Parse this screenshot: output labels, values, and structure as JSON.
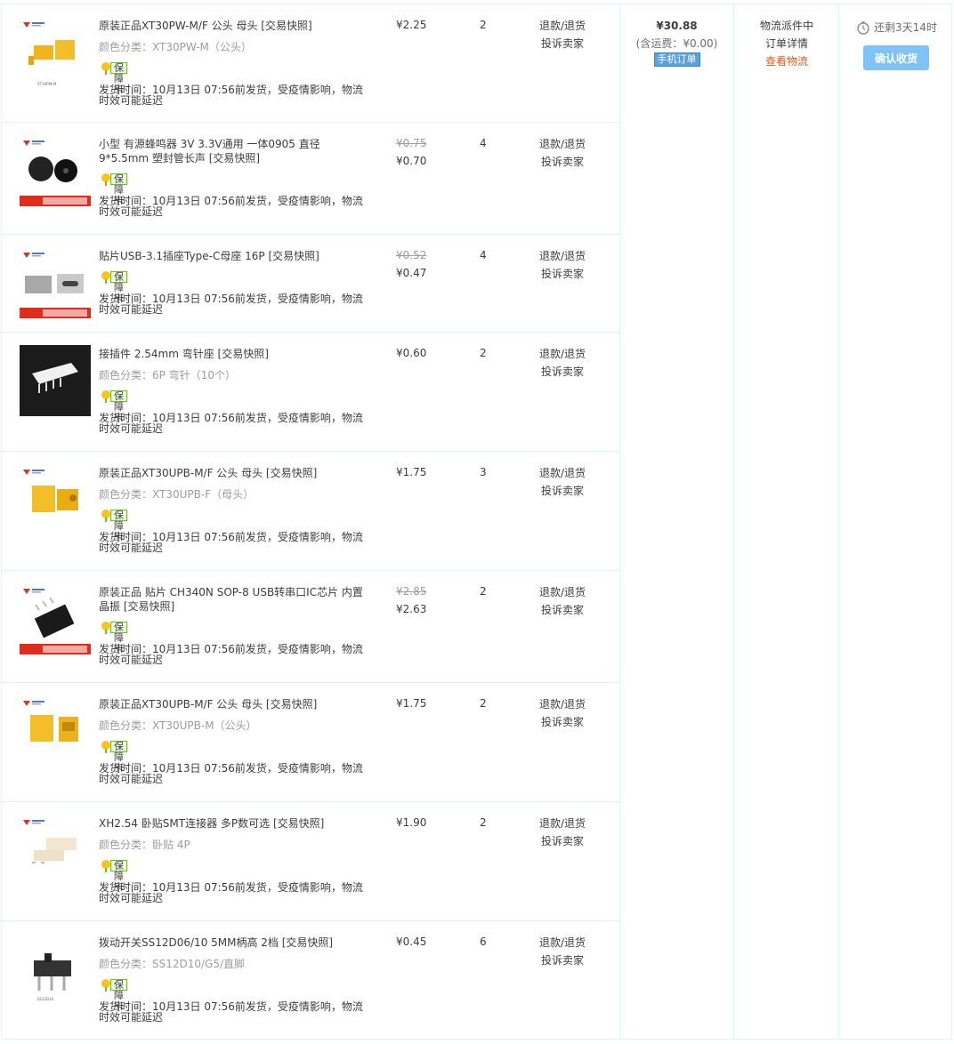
{
  "order": {
    "total_amount": "¥30.88",
    "shipping_note": "(含运费：¥0.00)",
    "mobile_tag": "手机订单",
    "status_text": "物流派件中",
    "order_detail": "订单详情",
    "view_logistics": "查看物流",
    "countdown": "还剩3天14时",
    "confirm_label": "确认收货"
  },
  "labels": {
    "badge": "保障卡",
    "refund": "退款/退货",
    "complain": "投诉卖家",
    "ship_line1": "发货时间：10月13日 07:56前发货，受疫情影响，物流",
    "ship_line2": "时效可能延迟"
  },
  "items": [
    {
      "title": "原装正品XT30PW-M/F 公头 母头 [交易快照]",
      "sku": "颜色分类：XT30PW-M（公头）",
      "price_old": "",
      "price": "¥2.25",
      "qty": "2",
      "thumb": "xt30pw"
    },
    {
      "title": "小型 有源蜂鸣器 3V 3.3V通用 一体0905 直径9*5.5mm 塑封管长声 [交易快照]",
      "sku": "",
      "price_old": "¥0.75",
      "price": "¥0.70",
      "qty": "4",
      "thumb": "buzzer"
    },
    {
      "title": "贴片USB-3.1插座Type-C母座 16P [交易快照]",
      "sku": "",
      "price_old": "¥0.52",
      "price": "¥0.47",
      "qty": "4",
      "thumb": "typec"
    },
    {
      "title": "接插件 2.54mm 弯针座 [交易快照]",
      "sku": "颜色分类：6P 弯针（10个）",
      "price_old": "",
      "price": "¥0.60",
      "qty": "2",
      "thumb": "header"
    },
    {
      "title": "原装正品XT30UPB-M/F 公头 母头 [交易快照]",
      "sku": "颜色分类：XT30UPB-F（母头）",
      "price_old": "",
      "price": "¥1.75",
      "qty": "3",
      "thumb": "xt30f"
    },
    {
      "title": "原装正品 贴片 CH340N SOP-8 USB转串口IC芯片 内置晶振 [交易快照]",
      "sku": "",
      "price_old": "¥2.85",
      "price": "¥2.63",
      "qty": "2",
      "thumb": "chip"
    },
    {
      "title": "原装正品XT30UPB-M/F 公头 母头 [交易快照]",
      "sku": "颜色分类：XT30UPB-M（公头）",
      "price_old": "",
      "price": "¥1.75",
      "qty": "2",
      "thumb": "xt30m"
    },
    {
      "title": "XH2.54 卧贴SMT连接器 多P数可选 [交易快照]",
      "sku": "颜色分类：卧贴 4P",
      "price_old": "",
      "price": "¥1.90",
      "qty": "2",
      "thumb": "xh"
    },
    {
      "title": "拨动开关SS12D06/10 5MM柄高 2档 [交易快照]",
      "sku": "颜色分类：SS12D10/G5/直脚",
      "price_old": "",
      "price": "¥0.45",
      "qty": "6",
      "thumb": "switch"
    }
  ]
}
